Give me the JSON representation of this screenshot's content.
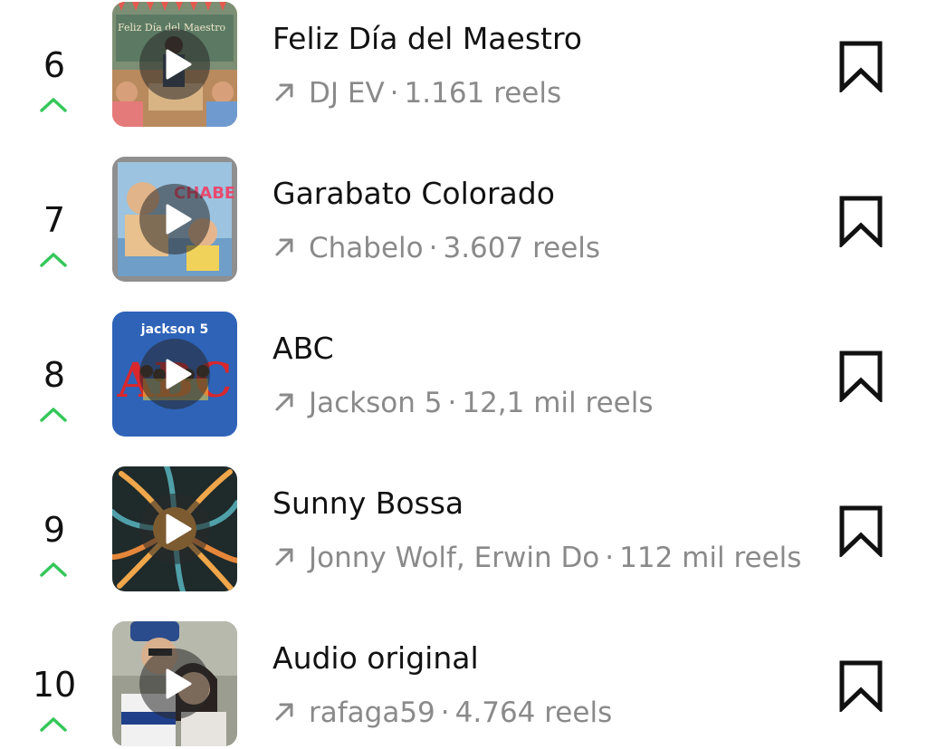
{
  "colors": {
    "trend_up": "#34c759",
    "meta_text": "#8a8a8a",
    "primary_text": "#111111"
  },
  "tracks": [
    {
      "rank": "6",
      "title": "Feliz Día del Maestro",
      "artist": "DJ EV",
      "reels": "1.161 reels",
      "cover_text": "Feliz Día del Maestro",
      "trend_icon": "chevron-up-icon",
      "save_icon": "bookmark-icon"
    },
    {
      "rank": "7",
      "title": "Garabato Colorado",
      "artist": "Chabelo",
      "reels": "3.607 reels",
      "cover_text": "CHABELO",
      "trend_icon": "chevron-up-icon",
      "save_icon": "bookmark-icon"
    },
    {
      "rank": "8",
      "title": "ABC",
      "artist": "Jackson 5",
      "reels": "12,1 mil reels",
      "cover_text": "jackson 5",
      "cover_text_2": "ABC",
      "trend_icon": "chevron-up-icon",
      "save_icon": "bookmark-icon"
    },
    {
      "rank": "9",
      "title": "Sunny Bossa",
      "artist": "Jonny Wolf, Erwin Do",
      "reels": "112 mil reels",
      "trend_icon": "chevron-up-icon",
      "save_icon": "bookmark-icon"
    },
    {
      "rank": "10",
      "title": "Audio original",
      "artist": "rafaga59",
      "reels": "4.764 reels",
      "trend_icon": "chevron-up-icon",
      "save_icon": "bookmark-icon"
    }
  ],
  "separator": "·"
}
